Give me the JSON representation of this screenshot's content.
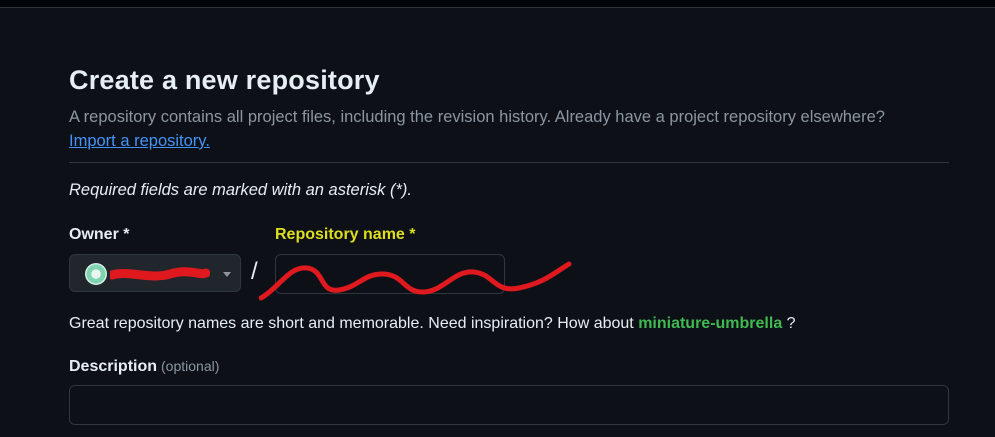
{
  "header": {
    "title": "Create a new repository",
    "subtitle": "A repository contains all project files, including the revision history. Already have a project repository elsewhere?",
    "import_link": "Import a repository."
  },
  "form": {
    "required_note": "Required fields are marked with an asterisk (*).",
    "owner_label": "Owner *",
    "separator": "/",
    "repo_name_label": "Repository name *",
    "repo_name_value": "",
    "suggestion_prefix": "Great repository names are short and memorable. Need inspiration? How about",
    "suggestion_name": "miniature-umbrella",
    "suggestion_suffix": "?",
    "description_label": "Description",
    "description_optional": "(optional)",
    "description_value": ""
  },
  "icons": {
    "owner_avatar": "avatar-icon",
    "owner_dropdown": "caret-down-icon"
  },
  "colors": {
    "background": "#0d1117",
    "link": "#4493f8",
    "suggestion": "#3fb950",
    "highlight_label": "#dede1f",
    "redaction": "#e0191e"
  }
}
